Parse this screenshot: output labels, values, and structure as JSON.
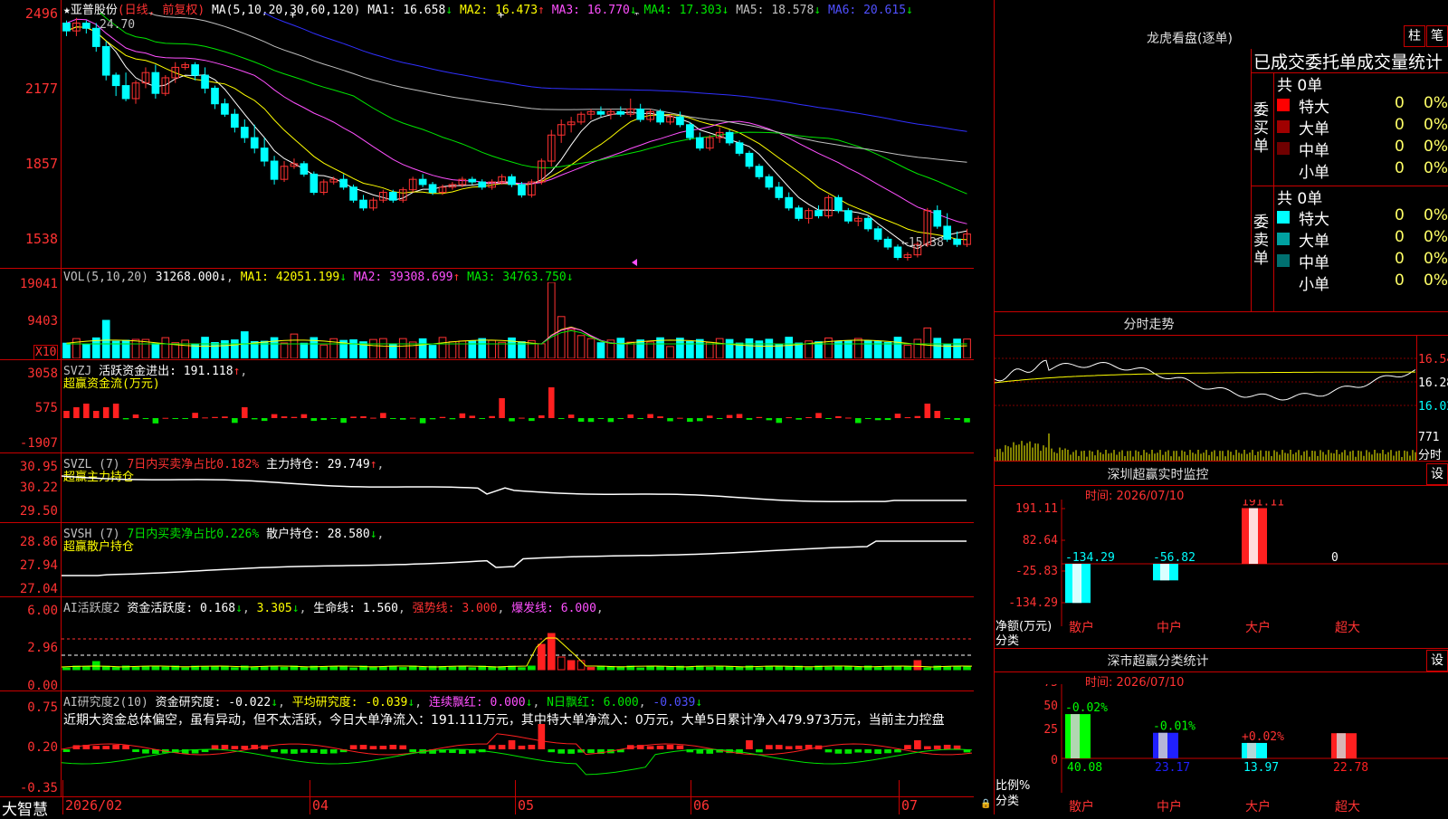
{
  "stock": {
    "name": "亚普股份",
    "period": "(日线, 前复权)",
    "ma_label": "MA(5,10,20,30,60,120)",
    "ma": [
      {
        "label": "MA1:",
        "value": "16.658",
        "arrow": "↓",
        "color": "#ffffff"
      },
      {
        "label": "MA2:",
        "value": "16.473",
        "arrow": "↑",
        "color": "#ffff00"
      },
      {
        "label": "MA3:",
        "value": "16.770",
        "arrow": "↓",
        "color": "#ff50ff"
      },
      {
        "label": "MA4:",
        "value": "17.303",
        "arrow": "↓",
        "color": "#00e600"
      },
      {
        "label": "MA5:",
        "value": "18.578",
        "arrow": "↓",
        "color": "#c0c0c0"
      },
      {
        "label": "MA6:",
        "value": "20.615",
        "arrow": "↓",
        "color": "#5050ff"
      }
    ],
    "y_ticks": [
      "2496",
      "2177",
      "1857",
      "1538"
    ],
    "high_label": "24.70",
    "low_label": "←15.38"
  },
  "vol": {
    "title": "VOL(5,10,20)",
    "value": "31268.000",
    "ma": [
      {
        "label": "MA1:",
        "value": "42051.199",
        "arrow": "↓",
        "color": "#ffff00"
      },
      {
        "label": "MA2:",
        "value": "39308.699",
        "arrow": "↑",
        "color": "#ff50ff"
      },
      {
        "label": "MA3:",
        "value": "34763.750",
        "arrow": "↓",
        "color": "#00e600"
      }
    ],
    "y_ticks": [
      "19041",
      "9403"
    ],
    "unit": "X10"
  },
  "svzj": {
    "title": "SVZJ",
    "label": "活跃资金进出:",
    "value": "191.118",
    "arrow": "↑",
    "sub": "超赢资金流(万元)",
    "y_ticks": [
      "3058",
      "575",
      "-1907"
    ]
  },
  "svzl": {
    "title": "SVZL (7)",
    "ratio_label": "7日内买卖净占比",
    "ratio_value": "0.182%",
    "hold_label": "主力持仓:",
    "hold_value": "29.749",
    "arrow": "↑",
    "sub": "超赢主力持仓",
    "y_ticks": [
      "30.95",
      "30.22",
      "29.50"
    ]
  },
  "svsh": {
    "title": "SVSH (7)",
    "ratio_label": "7日内买卖净占比",
    "ratio_value": "0.226%",
    "hold_label": "散户持仓:",
    "hold_value": "28.580",
    "arrow": "↓",
    "sub": "超赢散户持仓",
    "y_ticks": [
      "28.86",
      "27.94",
      "27.04"
    ]
  },
  "ai_active": {
    "title": "AI活跃度2",
    "label": "资金活跃度:",
    "v1": "0.168",
    "v2": "3.305",
    "life_label": "生命线:",
    "life": "1.560",
    "strong_label": "强势线:",
    "strong": "3.000",
    "burst_label": "爆发线:",
    "burst": "6.000",
    "y_ticks": [
      "6.00",
      "2.96",
      "0.00"
    ]
  },
  "ai_research": {
    "title": "AI研究度2(10)",
    "label": "资金研究度:",
    "v1": "-0.022",
    "avg_label": "平均研究度:",
    "avg": "-0.039",
    "cont_label": "连续飘红:",
    "cont": "0.000",
    "n_label": "N日飘红:",
    "n": "6.000",
    "last": "-0.039",
    "comment": "近期大资金总体偏空，虽有异动，但不太活跃，今日大单净流入：191.111万元，其中特大单净流入：0万元，大单5日累计净入479.973万元，当前主力控盘",
    "y_ticks": [
      "0.75",
      "0.20",
      "-0.35"
    ]
  },
  "x_axis": {
    "logo": "大智慧",
    "labels": [
      "2026/02",
      "04",
      "05",
      "06",
      "07"
    ]
  },
  "dragon": {
    "title": "龙虎看盘(逐单)",
    "btn1": "柱",
    "btn2": "笔",
    "heading": "已成交委托单成交量统计",
    "buy_side": "委买单",
    "sell_side": "委卖单",
    "buy_total": "共 0单",
    "sell_total": "共 0单",
    "buy_rows": [
      {
        "name": "特大",
        "n": "0",
        "p": "0%",
        "color": "#ff0000"
      },
      {
        "name": "大单",
        "n": "0",
        "p": "0%",
        "color": "#a00000"
      },
      {
        "name": "中单",
        "n": "0",
        "p": "0%",
        "color": "#700000"
      },
      {
        "name": "小单",
        "n": "0",
        "p": "0%",
        "color": "#000000"
      }
    ],
    "sell_rows": [
      {
        "name": "特大",
        "n": "0",
        "p": "0%",
        "color": "#00ffff"
      },
      {
        "name": "大单",
        "n": "0",
        "p": "0%",
        "color": "#00a0a0"
      },
      {
        "name": "中单",
        "n": "0",
        "p": "0%",
        "color": "#007070"
      },
      {
        "name": "小单",
        "n": "0",
        "p": "0%",
        "color": "#000000"
      }
    ]
  },
  "intraday": {
    "title": "分时走势",
    "prices": [
      "16.54",
      "16.28",
      "16.02"
    ],
    "vol": "771",
    "vol_unit": "分时"
  },
  "sz_monitor": {
    "title": "深圳超赢实时监控",
    "btn": "设",
    "time": "时间: 2026/07/10",
    "y_ticks": [
      "191.11",
      "82.64",
      "-25.83",
      "-134.29"
    ],
    "y_label": "净额(万元)",
    "x_label": "分类",
    "cats": [
      "散户",
      "中户",
      "大户",
      "超大"
    ],
    "values": [
      -134.29,
      -56.82,
      191.11,
      0
    ],
    "value_labels": [
      "-134.29",
      "-56.82",
      "191.11",
      "0"
    ]
  },
  "sz_class": {
    "title": "深市超赢分类统计",
    "btn": "设",
    "time": "时间: 2026/07/10",
    "y_ticks": [
      "75",
      "50",
      "25",
      "0"
    ],
    "y_label": "比例%",
    "x_label": "分类",
    "cats": [
      "散户",
      "中户",
      "大户",
      "超大"
    ],
    "values": [
      40.08,
      23.17,
      13.97,
      22.78
    ],
    "value_labels": [
      "40.08",
      "23.17",
      "13.97",
      "22.78"
    ],
    "changes": [
      "-0.02%",
      "-0.01%",
      "+0.02%",
      ""
    ],
    "colors": [
      "#00ff00",
      "#2020ff",
      "#00ffff",
      "#ff2020"
    ]
  },
  "chart_data": {
    "type": "candlestick",
    "title": "亚普股份 (日线, 前复权)",
    "x": [
      "2026/02",
      "04",
      "05",
      "06",
      "07"
    ],
    "ylim": [
      15.38,
      24.7
    ],
    "candles": [
      [
        24.5,
        24.6,
        24.0,
        24.2
      ],
      [
        24.2,
        24.7,
        24.0,
        24.5
      ],
      [
        24.5,
        24.6,
        24.1,
        24.3
      ],
      [
        24.3,
        24.5,
        23.4,
        23.6
      ],
      [
        23.6,
        23.8,
        22.3,
        22.5
      ],
      [
        22.5,
        22.6,
        21.7,
        22.1
      ],
      [
        22.1,
        22.6,
        21.5,
        21.6
      ],
      [
        21.6,
        22.3,
        21.4,
        22.2
      ],
      [
        22.2,
        22.8,
        22.0,
        22.6
      ],
      [
        22.6,
        22.9,
        21.6,
        21.8
      ],
      [
        21.8,
        22.5,
        21.7,
        22.4
      ],
      [
        22.4,
        23.0,
        22.2,
        22.8
      ],
      [
        22.8,
        23.0,
        22.7,
        22.9
      ],
      [
        22.9,
        23.0,
        22.3,
        22.5
      ],
      [
        22.5,
        22.8,
        21.8,
        22.0
      ],
      [
        22.0,
        22.1,
        21.2,
        21.4
      ],
      [
        21.4,
        21.6,
        20.9,
        21.0
      ],
      [
        21.0,
        21.2,
        20.3,
        20.5
      ],
      [
        20.5,
        20.8,
        19.9,
        20.1
      ],
      [
        20.1,
        20.6,
        19.5,
        19.7
      ],
      [
        19.7,
        20.1,
        19.0,
        19.2
      ],
      [
        19.2,
        19.4,
        18.3,
        18.5
      ],
      [
        18.5,
        19.2,
        18.4,
        19.0
      ],
      [
        19.0,
        19.3,
        18.9,
        19.1
      ],
      [
        19.1,
        19.2,
        18.6,
        18.7
      ],
      [
        18.7,
        18.8,
        17.9,
        18.0
      ],
      [
        18.0,
        18.5,
        17.9,
        18.4
      ],
      [
        18.4,
        18.6,
        18.3,
        18.5
      ],
      [
        18.5,
        18.7,
        18.1,
        18.2
      ],
      [
        18.2,
        18.3,
        17.6,
        17.7
      ],
      [
        17.7,
        17.9,
        17.3,
        17.4
      ],
      [
        17.4,
        17.8,
        17.3,
        17.7
      ],
      [
        17.7,
        18.1,
        17.6,
        18.0
      ],
      [
        18.0,
        18.1,
        17.6,
        17.7
      ],
      [
        17.7,
        18.2,
        17.6,
        18.1
      ],
      [
        18.1,
        18.6,
        18.0,
        18.5
      ],
      [
        18.5,
        18.7,
        18.2,
        18.3
      ],
      [
        18.3,
        18.4,
        17.9,
        18.0
      ],
      [
        18.0,
        18.3,
        17.9,
        18.2
      ],
      [
        18.2,
        18.4,
        18.1,
        18.3
      ],
      [
        18.3,
        18.6,
        18.2,
        18.5
      ],
      [
        18.5,
        18.6,
        18.3,
        18.4
      ],
      [
        18.4,
        18.5,
        18.1,
        18.2
      ],
      [
        18.2,
        18.5,
        18.1,
        18.4
      ],
      [
        18.4,
        18.7,
        18.3,
        18.6
      ],
      [
        18.6,
        18.7,
        18.2,
        18.3
      ],
      [
        18.3,
        18.4,
        17.8,
        17.9
      ],
      [
        17.9,
        18.5,
        17.8,
        18.4
      ],
      [
        18.4,
        19.3,
        18.3,
        19.2
      ],
      [
        19.2,
        20.4,
        19.0,
        20.2
      ],
      [
        20.2,
        20.8,
        19.9,
        20.6
      ],
      [
        20.6,
        20.9,
        20.3,
        20.7
      ],
      [
        20.7,
        21.1,
        20.6,
        21.0
      ],
      [
        21.0,
        21.2,
        20.8,
        21.1
      ],
      [
        21.1,
        21.3,
        20.9,
        21.0
      ],
      [
        21.0,
        21.2,
        20.8,
        21.1
      ],
      [
        21.1,
        21.3,
        20.9,
        21.0
      ],
      [
        21.0,
        21.6,
        20.9,
        21.2
      ],
      [
        21.2,
        21.4,
        20.7,
        20.8
      ],
      [
        20.8,
        21.2,
        20.7,
        21.1
      ],
      [
        21.1,
        21.2,
        20.6,
        20.7
      ],
      [
        20.7,
        21.0,
        20.6,
        20.9
      ],
      [
        20.9,
        21.1,
        20.5,
        20.6
      ],
      [
        20.6,
        20.7,
        20.0,
        20.1
      ],
      [
        20.1,
        20.3,
        19.6,
        19.7
      ],
      [
        19.7,
        20.2,
        19.6,
        20.1
      ],
      [
        20.1,
        20.5,
        19.9,
        20.3
      ],
      [
        20.3,
        20.4,
        19.8,
        19.9
      ],
      [
        19.9,
        20.0,
        19.4,
        19.5
      ],
      [
        19.5,
        19.6,
        18.9,
        19.0
      ],
      [
        19.0,
        19.1,
        18.5,
        18.6
      ],
      [
        18.6,
        18.7,
        18.1,
        18.2
      ],
      [
        18.2,
        18.4,
        17.7,
        17.8
      ],
      [
        17.8,
        18.0,
        17.3,
        17.4
      ],
      [
        17.4,
        17.5,
        16.9,
        17.0
      ],
      [
        17.0,
        17.4,
        16.8,
        17.3
      ],
      [
        17.3,
        17.5,
        17.0,
        17.1
      ],
      [
        17.1,
        17.9,
        17.0,
        17.8
      ],
      [
        17.8,
        17.9,
        17.2,
        17.3
      ],
      [
        17.3,
        17.4,
        16.8,
        16.9
      ],
      [
        16.9,
        17.1,
        16.7,
        17.0
      ],
      [
        17.0,
        17.1,
        16.5,
        16.6
      ],
      [
        16.6,
        16.7,
        16.1,
        16.2
      ],
      [
        16.2,
        16.3,
        15.8,
        15.9
      ],
      [
        15.9,
        16.0,
        15.4,
        15.5
      ],
      [
        15.5,
        15.7,
        15.38,
        15.6
      ],
      [
        15.6,
        16.1,
        15.5,
        16.0
      ],
      [
        16.0,
        17.4,
        15.9,
        17.3
      ],
      [
        17.3,
        17.5,
        16.6,
        16.7
      ],
      [
        16.7,
        17.2,
        16.1,
        16.2
      ],
      [
        16.2,
        16.5,
        15.9,
        16.0
      ],
      [
        16.0,
        16.6,
        15.9,
        16.4
      ]
    ]
  }
}
